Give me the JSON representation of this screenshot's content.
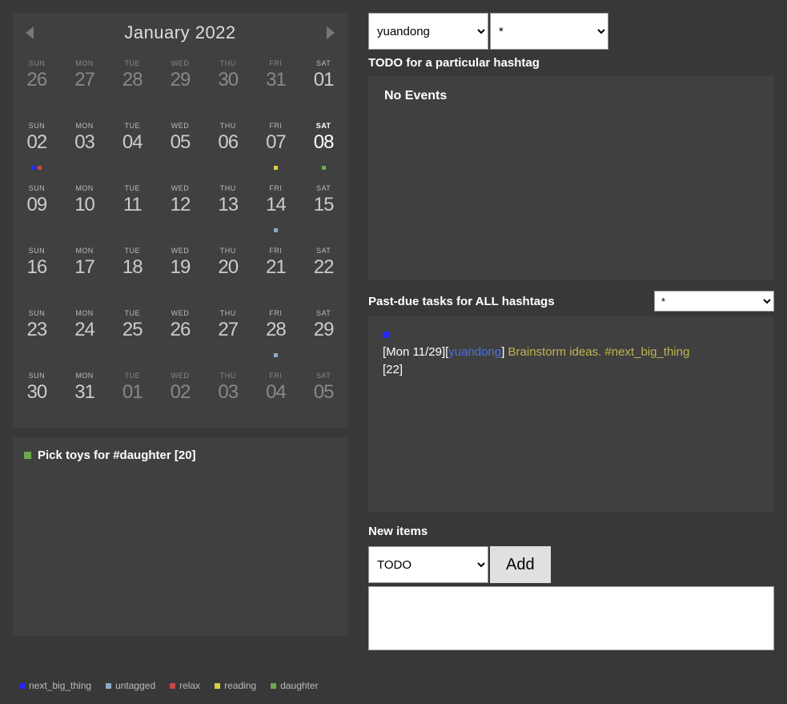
{
  "calendar": {
    "title": "January 2022",
    "dow": [
      "SUN",
      "MON",
      "TUE",
      "WED",
      "THU",
      "FRI",
      "SAT"
    ],
    "days": [
      {
        "n": "26",
        "cur": false
      },
      {
        "n": "27",
        "cur": false
      },
      {
        "n": "28",
        "cur": false
      },
      {
        "n": "29",
        "cur": false
      },
      {
        "n": "30",
        "cur": false
      },
      {
        "n": "31",
        "cur": false
      },
      {
        "n": "01",
        "cur": true
      },
      {
        "n": "02",
        "cur": true,
        "dots": [
          "#2727ff",
          "#c84545"
        ]
      },
      {
        "n": "03",
        "cur": true
      },
      {
        "n": "04",
        "cur": true
      },
      {
        "n": "05",
        "cur": true
      },
      {
        "n": "06",
        "cur": true
      },
      {
        "n": "07",
        "cur": true,
        "dots": [
          "#d8cf3f"
        ]
      },
      {
        "n": "08",
        "cur": true,
        "today": true,
        "dots": [
          "#6fa84e"
        ]
      },
      {
        "n": "09",
        "cur": true
      },
      {
        "n": "10",
        "cur": true
      },
      {
        "n": "11",
        "cur": true
      },
      {
        "n": "12",
        "cur": true
      },
      {
        "n": "13",
        "cur": true
      },
      {
        "n": "14",
        "cur": true,
        "dots": [
          "#8aa8c9"
        ]
      },
      {
        "n": "15",
        "cur": true
      },
      {
        "n": "16",
        "cur": true
      },
      {
        "n": "17",
        "cur": true
      },
      {
        "n": "18",
        "cur": true
      },
      {
        "n": "19",
        "cur": true
      },
      {
        "n": "20",
        "cur": true
      },
      {
        "n": "21",
        "cur": true
      },
      {
        "n": "22",
        "cur": true
      },
      {
        "n": "23",
        "cur": true
      },
      {
        "n": "24",
        "cur": true
      },
      {
        "n": "25",
        "cur": true
      },
      {
        "n": "26",
        "cur": true
      },
      {
        "n": "27",
        "cur": true
      },
      {
        "n": "28",
        "cur": true,
        "dots": [
          "#8aa8c9"
        ]
      },
      {
        "n": "29",
        "cur": true
      },
      {
        "n": "30",
        "cur": true
      },
      {
        "n": "31",
        "cur": true
      },
      {
        "n": "01",
        "cur": false
      },
      {
        "n": "02",
        "cur": false
      },
      {
        "n": "03",
        "cur": false
      },
      {
        "n": "04",
        "cur": false
      },
      {
        "n": "05",
        "cur": false
      }
    ]
  },
  "selected_event": {
    "color": "#6fa84e",
    "text": "Pick toys for #daughter [20]"
  },
  "legend": [
    {
      "color": "#2727ff",
      "label": "next_big_thing"
    },
    {
      "color": "#8aa8c9",
      "label": "untagged"
    },
    {
      "color": "#c84545",
      "label": "relax"
    },
    {
      "color": "#d8cf3f",
      "label": "reading"
    },
    {
      "color": "#6fa84e",
      "label": "daughter"
    }
  ],
  "right": {
    "user_select": "yuandong",
    "hash_select": "*",
    "todo_title": "TODO for a particular hashtag",
    "no_events": "No Events",
    "pastdue_title": "Past-due tasks for ALL hashtags",
    "pastdue_select": "*",
    "past_task": {
      "date": "[Mon 11/29]",
      "bracket_open": "[",
      "user": "yuandong",
      "bracket_close": "]",
      "text": " Brainstorm ideas. #next_big_thing ",
      "id": "[22]"
    },
    "new_items_title": "New items",
    "todo_select": "TODO",
    "add_label": "Add"
  }
}
